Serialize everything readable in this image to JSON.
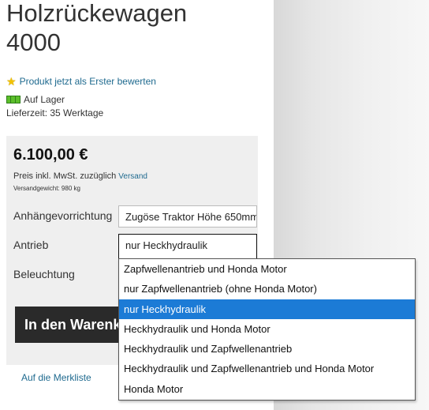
{
  "product": {
    "title_line1": "Holzrückewagen",
    "title_line2": "4000",
    "rating_link": "Produkt jetzt als Erster bewerten",
    "stock": "Auf Lager",
    "delivery": "Lieferzeit: 35 Werktage"
  },
  "price": {
    "amount": "6.100,00 €",
    "note": "Preis inkl. MwSt. zuzüglich",
    "shipping_link": "Versand",
    "weight": "Versandgewicht: 980 kg"
  },
  "options": {
    "hitch_label": "Anhängevorrichtung",
    "hitch_value": "Zugöse Traktor Höhe 650mm",
    "drive_label": "Antrieb",
    "drive_value": "nur Heckhydraulik",
    "light_label": "Beleuchtung",
    "drive_options": [
      "Zapfwellenantrieb und Honda Motor",
      "nur Zapfwellenantrieb (ohne Honda Motor)",
      "nur Heckhydraulik",
      "Heckhydraulik und Honda Motor",
      "Heckhydraulik und Zapfwellenantrieb",
      "Heckhydraulik und Zapfwellenantrieb und Honda Motor",
      "Honda Motor"
    ],
    "selected_index": 2
  },
  "actions": {
    "cart_button": "In den Warenkorb",
    "wishlist": "Auf die Merkliste"
  },
  "colors": {
    "accent_link": "#1f6a8f",
    "highlight": "#1c7bd6"
  }
}
